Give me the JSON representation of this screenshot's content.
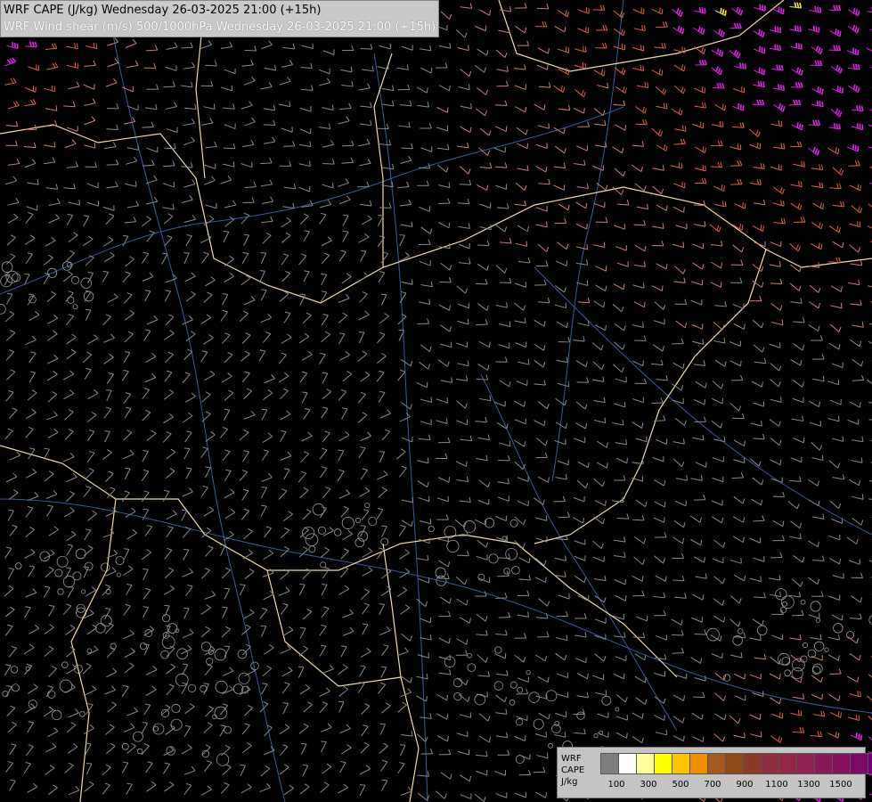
{
  "title": {
    "line1": "WRF CAPE (J/kg) Wednesday 26-03-2025 21:00 (+15h)",
    "line2": "WRF Wind shear (m/s) 500/1000hPa Wednesday 26-03-2025 21:00 (+15h)"
  },
  "legend": {
    "label_lines": [
      "WRF",
      "CAPE",
      "J/kg"
    ],
    "colors": [
      "#7f7f7f",
      "#ffffff",
      "#ffff9c",
      "#ffff00",
      "#ffc400",
      "#f09000",
      "#a45a1e",
      "#8e4a1a",
      "#8a3a2a",
      "#8e3040",
      "#922848",
      "#8f2050",
      "#8a1858",
      "#860f5e",
      "#7c0a62",
      "#700070"
    ],
    "tick_labels": [
      "100",
      "300",
      "500",
      "700",
      "900",
      "1100",
      "1300",
      "1500"
    ]
  },
  "map": {
    "barb_colors": {
      "weak": "#8a8a8a",
      "moderate": "#c88078",
      "strong": "#e06050",
      "very_strong": "#e020e8",
      "extreme": "#f0f020"
    },
    "border_color": "#f0d8b0",
    "river_color": "#3a5aa0",
    "contour_color": "#9a9a9a"
  }
}
